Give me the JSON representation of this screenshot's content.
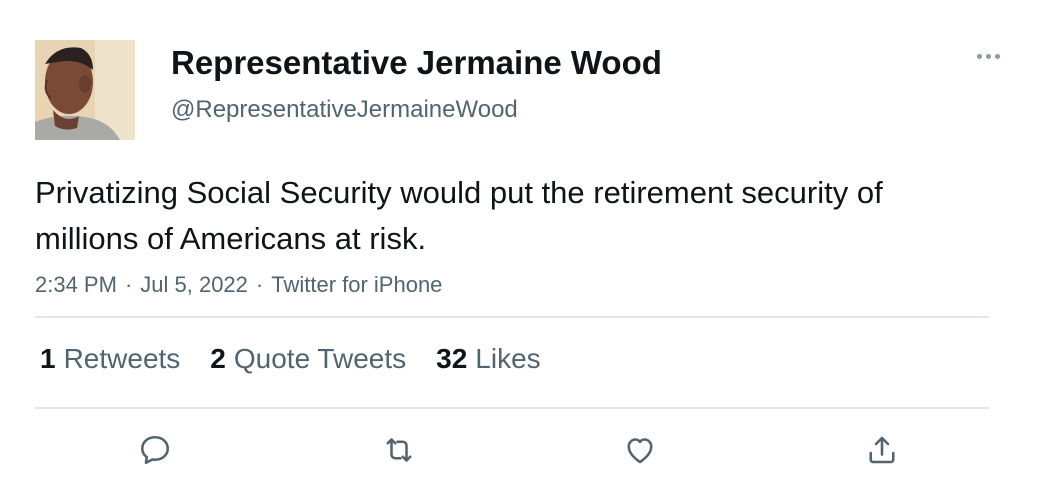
{
  "author": {
    "name": "Representative Jermaine Wood",
    "handle": "@RepresentativeJermaineWood",
    "avatar_icon": "profile-photo"
  },
  "tweet": {
    "text": "Privatizing Social Security would put the retirement security of millions of Americans at risk.",
    "time": "2:34 PM",
    "date": "Jul 5, 2022",
    "source": "Twitter for iPhone",
    "separator": "·"
  },
  "stats": {
    "retweets": {
      "count": "1",
      "label": "Retweets"
    },
    "quote_tweets": {
      "count": "2",
      "label": "Quote Tweets"
    },
    "likes": {
      "count": "32",
      "label": "Likes"
    }
  },
  "actions": [
    "reply-icon",
    "retweet-icon",
    "like-icon",
    "share-icon"
  ],
  "colors": {
    "text_primary": "#0f1419",
    "text_secondary": "#536471",
    "divider": "#e1e6ea",
    "icon": "#536471"
  }
}
